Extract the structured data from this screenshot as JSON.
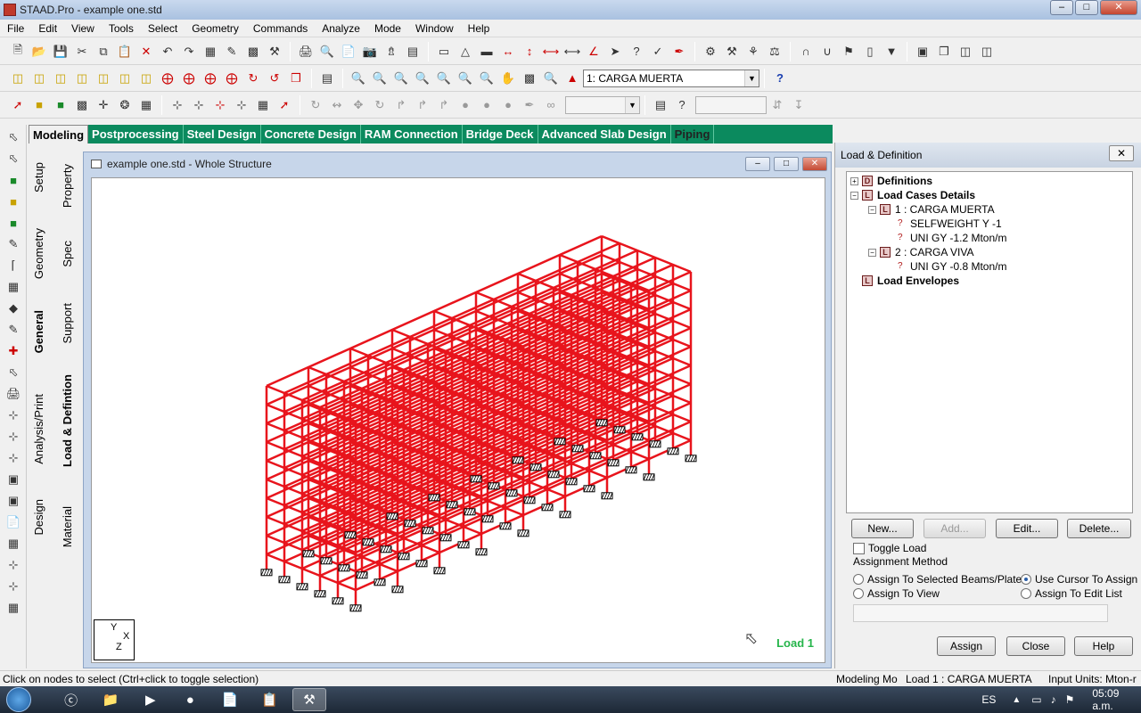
{
  "window": {
    "title": "STAAD.Pro - example one.std"
  },
  "menu": [
    "File",
    "Edit",
    "View",
    "Tools",
    "Select",
    "Geometry",
    "Commands",
    "Analyze",
    "Mode",
    "Window",
    "Help"
  ],
  "toolbar": {
    "load_case_select": "1: CARGA MUERTA",
    "help_icon": "?"
  },
  "mode_tabs": [
    "Modeling",
    "Postprocessing",
    "Steel Design",
    "Concrete Design",
    "RAM Connection",
    "Bridge Deck",
    "Advanced Slab Design",
    "Piping"
  ],
  "vertical_tabs_outer": [
    "Setup",
    "Geometry",
    "General",
    "Analysis/Print",
    "Design"
  ],
  "vertical_tabs_inner": [
    "Property",
    "Spec",
    "Support",
    "Load & Defintion",
    "Material"
  ],
  "document": {
    "title": "example one.std - Whole Structure",
    "load_label": "Load 1",
    "axis_y": "Y",
    "axis_x": "X",
    "axis_z": "Z"
  },
  "panel": {
    "title": "Load & Definition",
    "tree": [
      {
        "label": "Definitions",
        "bold": true,
        "level": 0,
        "exp": "+"
      },
      {
        "label": "Load Cases Details",
        "bold": true,
        "level": 0,
        "exp": "−"
      },
      {
        "label": "1 : CARGA MUERTA",
        "bold": false,
        "level": 1,
        "exp": "−"
      },
      {
        "label": "SELFWEIGHT Y -1",
        "bold": false,
        "level": 2,
        "exp": ""
      },
      {
        "label": "UNI GY -1.2 Mton/m",
        "bold": false,
        "level": 2,
        "exp": ""
      },
      {
        "label": "2 : CARGA VIVA",
        "bold": false,
        "level": 1,
        "exp": "−"
      },
      {
        "label": "UNI GY -0.8 Mton/m",
        "bold": false,
        "level": 2,
        "exp": ""
      },
      {
        "label": "Load Envelopes",
        "bold": true,
        "level": 0,
        "exp": ""
      }
    ],
    "buttons": {
      "new": "New...",
      "add": "Add...",
      "edit": "Edit...",
      "delete": "Delete...",
      "assign": "Assign",
      "close": "Close",
      "help": "Help"
    },
    "toggle_load": "Toggle Load",
    "assignment_method": "Assignment Method",
    "radio": {
      "selected_beams": "Assign To Selected Beams/Plates",
      "use_cursor": "Use Cursor To Assign",
      "to_view": "Assign To View",
      "edit_list": "Assign To Edit List"
    }
  },
  "status": {
    "left": "Click on nodes to select (Ctrl+click to toggle selection)",
    "mode": "Modeling Mo",
    "load": "Load 1 : CARGA MUERTA",
    "units": "Input Units:  Mton-r"
  },
  "taskbar": {
    "lang": "ES",
    "time": "05:09 a.m."
  },
  "colors": {
    "structure": "#e8141c",
    "tab_bar": "#0b8a5e",
    "load_label": "#26b54b"
  }
}
